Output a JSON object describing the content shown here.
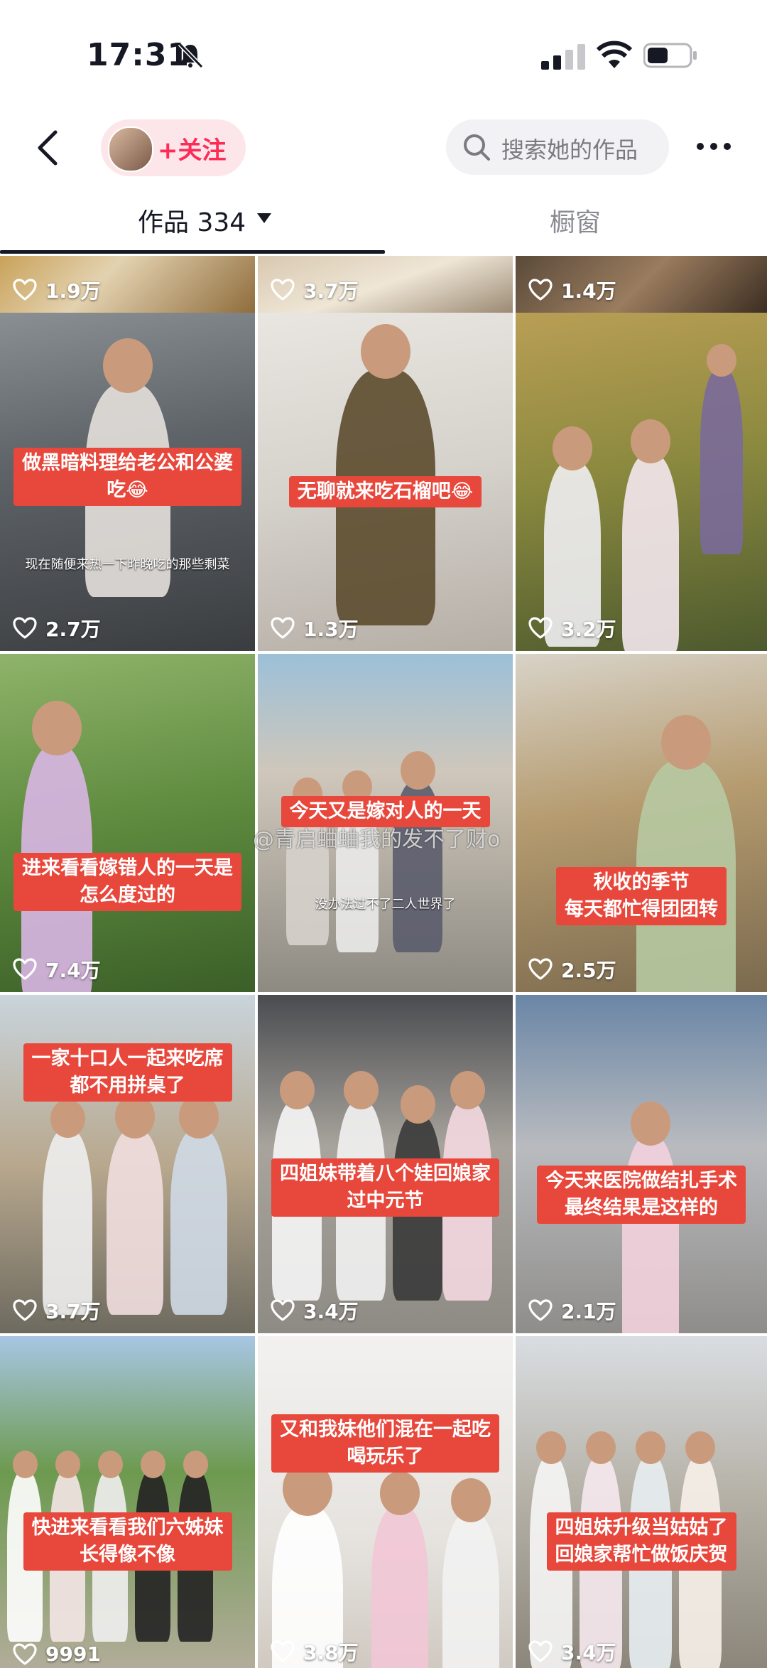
{
  "status_bar": {
    "time": "17:31"
  },
  "header": {
    "follow_label": "+关注",
    "search_placeholder": "搜索她的作品"
  },
  "tabs": {
    "works_label": "作品 334",
    "shop_label": "橱窗"
  },
  "watermark": "@青启蛐蛐我的发不了财o",
  "videos": [
    {
      "likes": "1.9万",
      "caption": "",
      "subtitle": ""
    },
    {
      "likes": "3.7万",
      "caption": "",
      "subtitle": ""
    },
    {
      "likes": "1.4万",
      "caption": "",
      "subtitle": ""
    },
    {
      "likes": "2.7万",
      "caption": "做黑暗料理给老公和公婆\n吃😂",
      "subtitle": "现在随便来热一下昨晚吃的那些剩菜"
    },
    {
      "likes": "1.3万",
      "caption": "无聊就来吃石榴吧😂",
      "subtitle": ""
    },
    {
      "likes": "3.2万",
      "caption": "",
      "subtitle": ""
    },
    {
      "likes": "7.4万",
      "caption": "进来看看嫁错人的一天是\n怎么度过的",
      "subtitle": ""
    },
    {
      "likes": "",
      "caption": "今天又是嫁对人的一天",
      "subtitle": "没办法过不了二人世界了"
    },
    {
      "likes": "2.5万",
      "caption": "秋收的季节\n每天都忙得团团转",
      "subtitle": ""
    },
    {
      "likes": "3.7万",
      "caption": "一家十口人一起来吃席\n都不用拼桌了",
      "subtitle": ""
    },
    {
      "likes": "3.4万",
      "caption": "四姐妹带着八个娃回娘家\n过中元节",
      "subtitle": ""
    },
    {
      "likes": "2.1万",
      "caption": "今天来医院做结扎手术\n最终结果是这样的",
      "subtitle": ""
    },
    {
      "likes": "9991",
      "caption": "快进来看看我们六姊妹\n长得像不像",
      "subtitle": ""
    },
    {
      "likes": "3.8万",
      "caption": "又和我妹他们混在一起吃\n喝玩乐了",
      "subtitle": ""
    },
    {
      "likes": "3.4万",
      "caption": "四姐妹升级当姑姑了\n回娘家帮忙做饭庆贺",
      "subtitle": ""
    }
  ]
}
